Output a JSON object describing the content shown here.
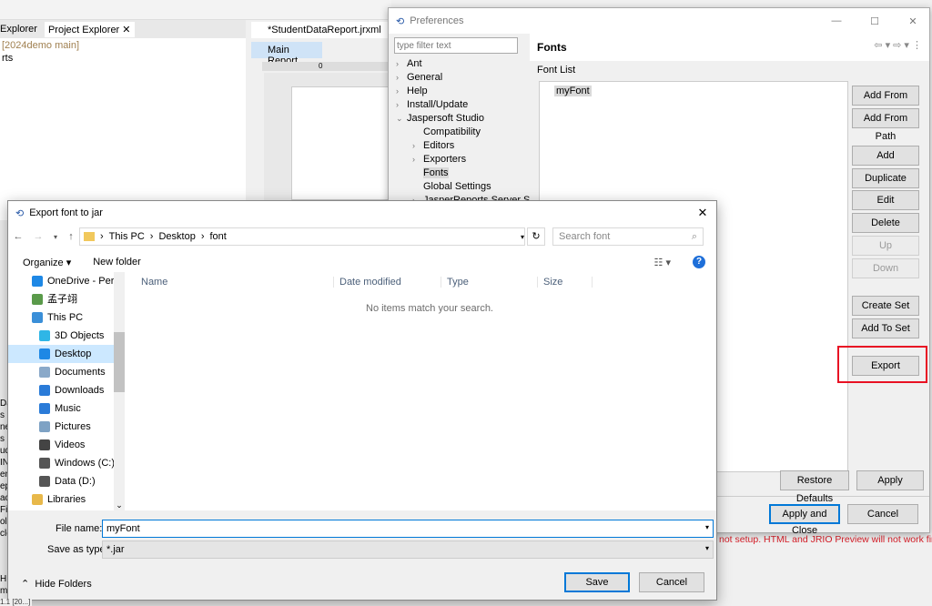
{
  "ide": {
    "left_tabs": [
      "Explorer",
      "Project Explorer"
    ],
    "project_label": "[2024demo main]",
    "tree_item": "rts",
    "editor_tab": "*StudentDataReport.jrxml",
    "main_report": "Main Report",
    "ruler_zero": "0",
    "left_fragments": [
      "Da",
      "s",
      "ne",
      "s",
      "ud",
      "IN",
      "en",
      "ep",
      "ac",
      "Fie",
      "ol",
      "cle",
      "",
      "H",
      "m",
      "1.1 [20...]"
    ],
    "warning": "not setup. HTML and JRIO Preview will not work fine"
  },
  "prefs": {
    "title": "Preferences",
    "filter_placeholder": "type filter text",
    "tree": [
      {
        "label": "Ant",
        "level": 0,
        "arrow": ">"
      },
      {
        "label": "General",
        "level": 0,
        "arrow": ">"
      },
      {
        "label": "Help",
        "level": 0,
        "arrow": ">"
      },
      {
        "label": "Install/Update",
        "level": 0,
        "arrow": ">"
      },
      {
        "label": "Jaspersoft Studio",
        "level": 0,
        "arrow": "v"
      },
      {
        "label": "Compatibility",
        "level": 1,
        "arrow": ""
      },
      {
        "label": "Editors",
        "level": 1,
        "arrow": ">"
      },
      {
        "label": "Exporters",
        "level": 1,
        "arrow": ">"
      },
      {
        "label": "Fonts",
        "level": 1,
        "arrow": "",
        "selected": true
      },
      {
        "label": "Global Settings",
        "level": 1,
        "arrow": ""
      },
      {
        "label": "JasperReports Server Sett",
        "level": 1,
        "arrow": ">"
      }
    ],
    "page_title": "Fonts",
    "font_list_label": "Font List",
    "fonts": [
      "myFont"
    ],
    "buttons": {
      "add_url": "Add From URL",
      "add_path": "Add From Path",
      "add": "Add",
      "duplicate": "Duplicate",
      "edit": "Edit",
      "delete": "Delete",
      "up": "Up",
      "down": "Down",
      "create_set": "Create Set",
      "add_to_set": "Add To Set",
      "export": "Export",
      "restore": "Restore Defaults",
      "apply": "Apply",
      "apply_close": "Apply and Close",
      "cancel": "Cancel"
    },
    "highlight_color": "#e81123"
  },
  "save": {
    "title": "Export font to jar",
    "breadcrumb": [
      "This PC",
      "Desktop",
      "font"
    ],
    "search_placeholder": "Search font",
    "organize": "Organize ▾",
    "new_folder": "New folder",
    "nav": [
      {
        "label": "OneDrive - Perso",
        "icon": "cloud-icon",
        "color": "#1e88e5"
      },
      {
        "label": "孟子翊",
        "icon": "user-icon",
        "color": "#5a9a4a"
      },
      {
        "label": "This PC",
        "icon": "computer-icon",
        "color": "#3a8fd8"
      },
      {
        "label": "3D Objects",
        "icon": "cube-icon",
        "color": "#2fb6e6",
        "indent": 1
      },
      {
        "label": "Desktop",
        "icon": "desktop-icon",
        "color": "#1e88e5",
        "indent": 1,
        "selected": true
      },
      {
        "label": "Documents",
        "icon": "document-icon",
        "color": "#8aa9c9",
        "indent": 1
      },
      {
        "label": "Downloads",
        "icon": "download-icon",
        "color": "#2a7bd8",
        "indent": 1
      },
      {
        "label": "Music",
        "icon": "music-icon",
        "color": "#2a7bd8",
        "indent": 1
      },
      {
        "label": "Pictures",
        "icon": "pictures-icon",
        "color": "#7ea2c4",
        "indent": 1
      },
      {
        "label": "Videos",
        "icon": "videos-icon",
        "color": "#444",
        "indent": 1
      },
      {
        "label": "Windows (C:)",
        "icon": "drive-icon",
        "color": "#555",
        "indent": 1
      },
      {
        "label": "Data (D:)",
        "icon": "drive-icon",
        "color": "#555",
        "indent": 1
      },
      {
        "label": "Libraries",
        "icon": "libraries-icon",
        "color": "#e8b84a"
      }
    ],
    "columns": [
      "Name",
      "Date modified",
      "Type",
      "Size"
    ],
    "empty": "No items match your search.",
    "file_name_label": "File name:",
    "file_name": "myFont",
    "type_label": "Save as type:",
    "type": "*.jar",
    "hide_folders": "Hide Folders",
    "save": "Save",
    "cancel": "Cancel"
  }
}
